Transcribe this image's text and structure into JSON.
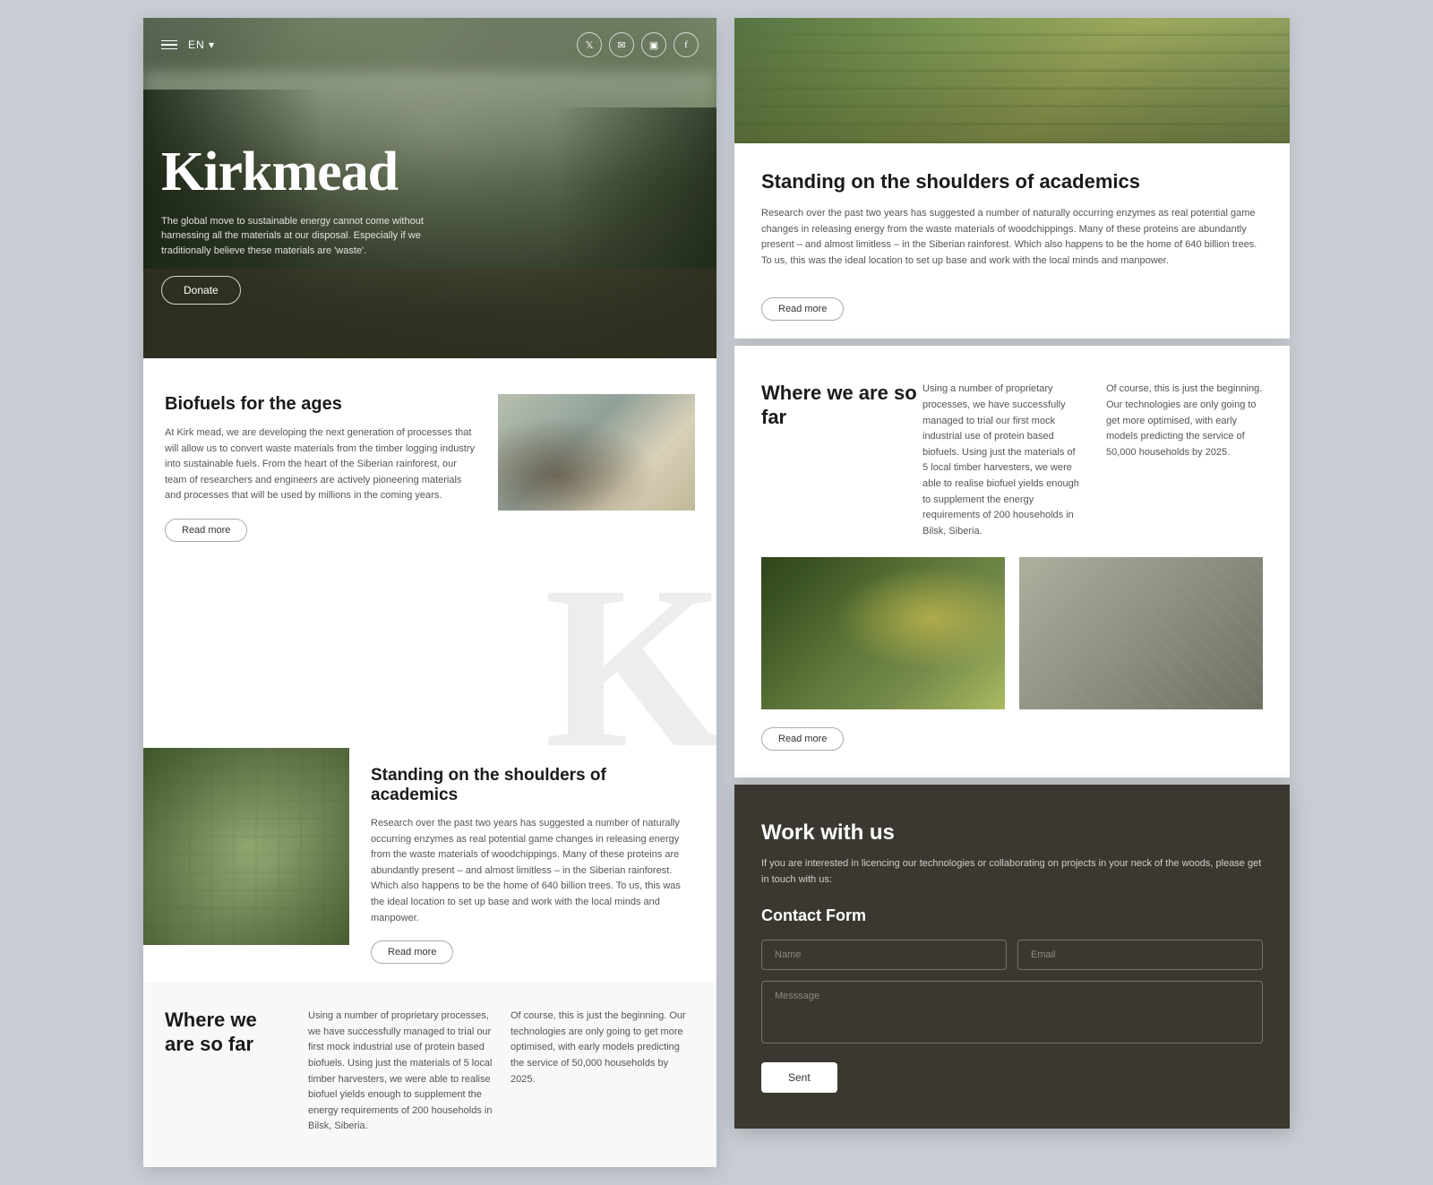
{
  "site": {
    "title": "Kirkmead",
    "lang": "EN"
  },
  "nav": {
    "lang_label": "EN ▾",
    "social": [
      "twitter",
      "email",
      "instagram",
      "facebook"
    ]
  },
  "hero": {
    "title": "Kirkmead",
    "subtitle": "The global move to sustainable energy cannot come without harnessing all the materials at our disposal. Especially if we traditionally believe these materials are 'waste'.",
    "donate_btn": "Donate"
  },
  "sections": {
    "biofuels": {
      "title": "Biofuels for the ages",
      "body": "At Kirk mead, we are developing the next generation of processes that will allow us to convert waste materials from the timber logging industry into sustainable fuels. From the heart of the Siberian rainforest, our team of researchers and engineers are actively pioneering materials and processes that will be used by millions in the coming years.",
      "read_more": "Read more"
    },
    "academics": {
      "title": "Standing on the shoulders of academics",
      "body": "Research over the past two years has suggested a number of naturally occurring enzymes as real potential game changes in releasing energy from the waste materials of woodchippings. Many of these proteins are abundantly present – and almost limitless – in the Siberian rainforest. Which also happens to be the home of 640 billion trees. To us, this was the ideal location to set up base and work with the local minds and manpower.",
      "read_more": "Read more"
    },
    "where": {
      "title": "Where we are so far",
      "col1": "Using a number of proprietary processes, we have successfully managed to trial our first mock industrial use of protein based biofuels. Using just the materials of 5 local timber harvesters, we were able to realise biofuel yields enough to supplement the energy requirements of 200 households in Bilsk, Siberia.",
      "col2": "Of course, this is just the beginning. Our technologies are only going to get more optimised, with early models predicting the service of 50,000 households by 2025.",
      "read_more": "Read more"
    },
    "contact": {
      "title": "Work with us",
      "desc": "If you are interested in licencing our technologies or collaborating on projects in your neck of the woods, please get in touch with us:",
      "form_title": "Contact Form",
      "name_placeholder": "Name",
      "email_placeholder": "Email",
      "message_placeholder": "Messsage",
      "submit_btn": "Sent"
    }
  },
  "icons": {
    "twitter": "𝕏",
    "email": "✉",
    "instagram": "◻",
    "facebook": "f"
  }
}
